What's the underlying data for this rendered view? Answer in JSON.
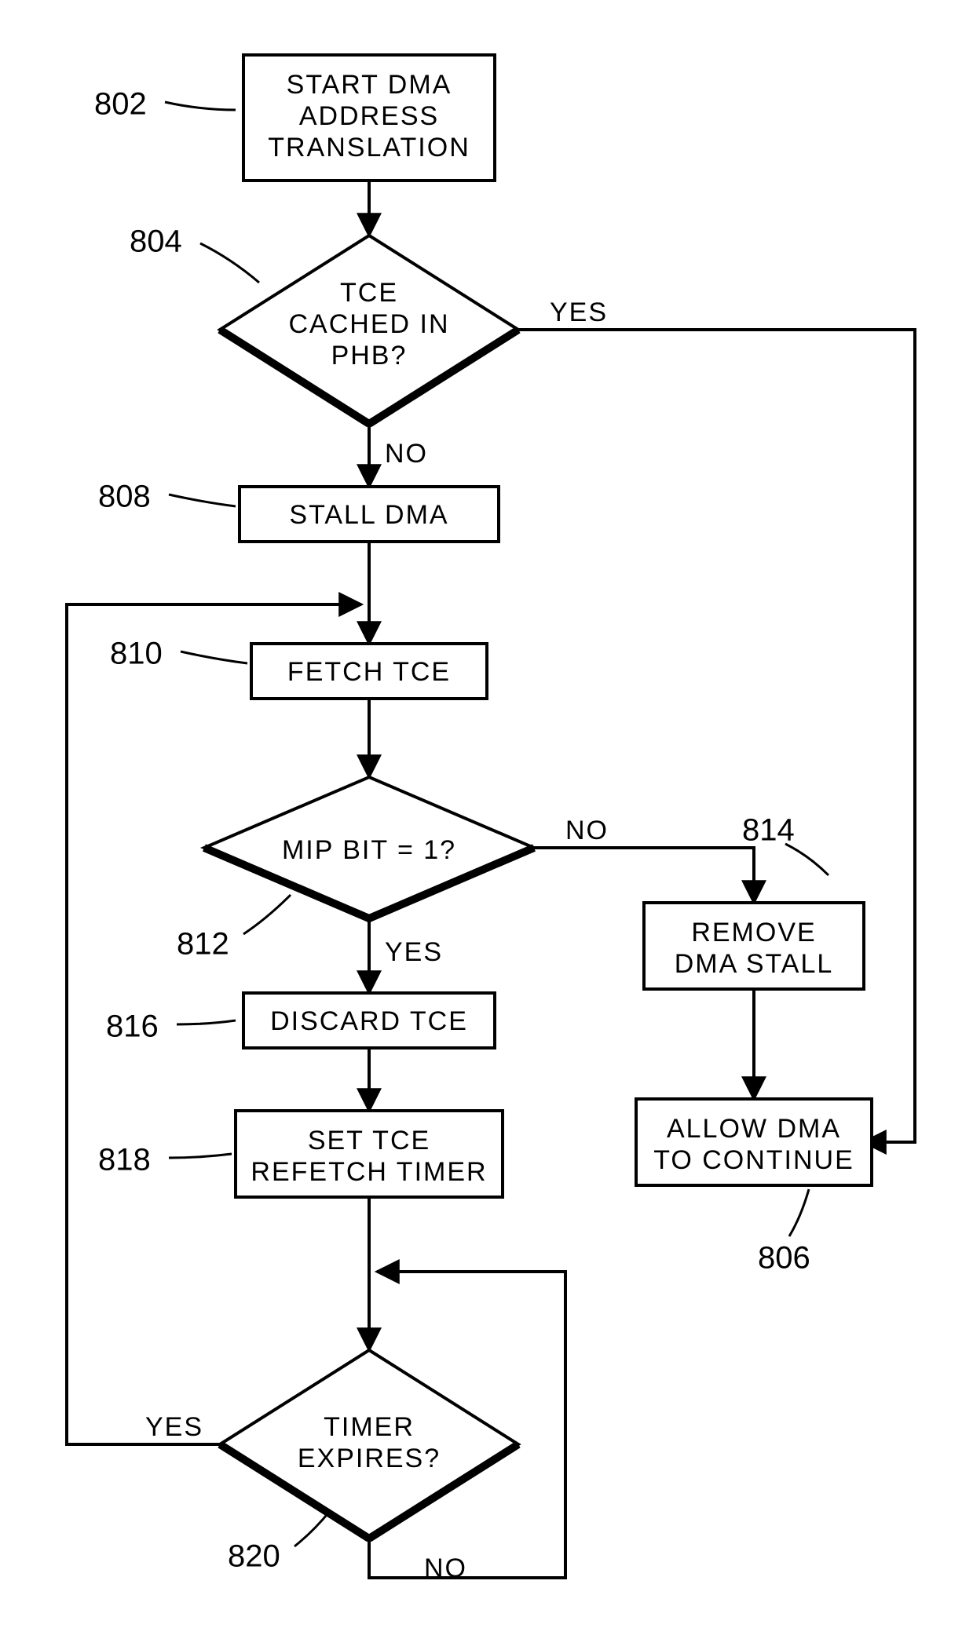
{
  "chart_data": {
    "type": "flowchart",
    "title": "",
    "nodes": [
      {
        "id": "n802",
        "ref": "802",
        "type": "process",
        "lines": [
          "START DMA",
          "ADDRESS",
          "TRANSLATION"
        ]
      },
      {
        "id": "n804",
        "ref": "804",
        "type": "decision",
        "lines": [
          "TCE",
          "CACHED IN",
          "PHB?"
        ]
      },
      {
        "id": "n808",
        "ref": "808",
        "type": "process",
        "lines": [
          "STALL DMA"
        ]
      },
      {
        "id": "n810",
        "ref": "810",
        "type": "process",
        "lines": [
          "FETCH TCE"
        ]
      },
      {
        "id": "n812",
        "ref": "812",
        "type": "decision",
        "lines": [
          "MIP BIT = 1?"
        ]
      },
      {
        "id": "n814",
        "ref": "814",
        "type": "process",
        "lines": [
          "REMOVE",
          "DMA STALL"
        ]
      },
      {
        "id": "n816",
        "ref": "816",
        "type": "process",
        "lines": [
          "DISCARD TCE"
        ]
      },
      {
        "id": "n818",
        "ref": "818",
        "type": "process",
        "lines": [
          "SET TCE",
          "REFETCH TIMER"
        ]
      },
      {
        "id": "n806",
        "ref": "806",
        "type": "process",
        "lines": [
          "ALLOW DMA",
          "TO CONTINUE"
        ]
      },
      {
        "id": "n820",
        "ref": "820",
        "type": "decision",
        "lines": [
          "TIMER",
          "EXPIRES?"
        ]
      }
    ],
    "edges": [
      {
        "from": "n802",
        "to": "n804",
        "label": ""
      },
      {
        "from": "n804",
        "to": "n808",
        "label": "NO"
      },
      {
        "from": "n804",
        "to": "n806",
        "label": "YES"
      },
      {
        "from": "n808",
        "to": "n810",
        "label": ""
      },
      {
        "from": "n810",
        "to": "n812",
        "label": ""
      },
      {
        "from": "n812",
        "to": "n816",
        "label": "YES"
      },
      {
        "from": "n812",
        "to": "n814",
        "label": "NO"
      },
      {
        "from": "n814",
        "to": "n806",
        "label": ""
      },
      {
        "from": "n816",
        "to": "n818",
        "label": ""
      },
      {
        "from": "n818",
        "to": "n820",
        "label": ""
      },
      {
        "from": "n820",
        "to": "n810",
        "label": "YES"
      },
      {
        "from": "n820",
        "to": "n820",
        "label": "NO",
        "note": "loop back to same node input"
      }
    ]
  },
  "labels": {
    "yes": "YES",
    "no": "NO"
  },
  "refs": {
    "n802": "802",
    "n804": "804",
    "n808": "808",
    "n810": "810",
    "n812": "812",
    "n814": "814",
    "n816": "816",
    "n818": "818",
    "n806": "806",
    "n820": "820"
  }
}
